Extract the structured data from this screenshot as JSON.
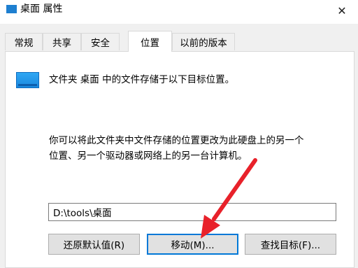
{
  "window": {
    "title": "桌面 属性",
    "close_symbol": "✕"
  },
  "tabs": [
    {
      "label": "常规"
    },
    {
      "label": "共享"
    },
    {
      "label": "安全"
    },
    {
      "label": "位置",
      "active": true
    },
    {
      "label": "以前的版本"
    }
  ],
  "location": {
    "header": "文件夹 桌面 中的文件存储于以下目标位置。",
    "description_line1": "你可以将此文件夹中文件存储的位置更改为此硬盘上的另一个",
    "description_line2": "位置、另一个驱动器或网络上的另一台计算机。",
    "path_value": "D:\\tools\\桌面"
  },
  "buttons": {
    "restore_default": "还原默认值(R)",
    "move": "移动(M)...",
    "find_target": "查找目标(F)..."
  },
  "colors": {
    "accent": "#0078d7",
    "annotation_arrow": "#e8212a"
  }
}
